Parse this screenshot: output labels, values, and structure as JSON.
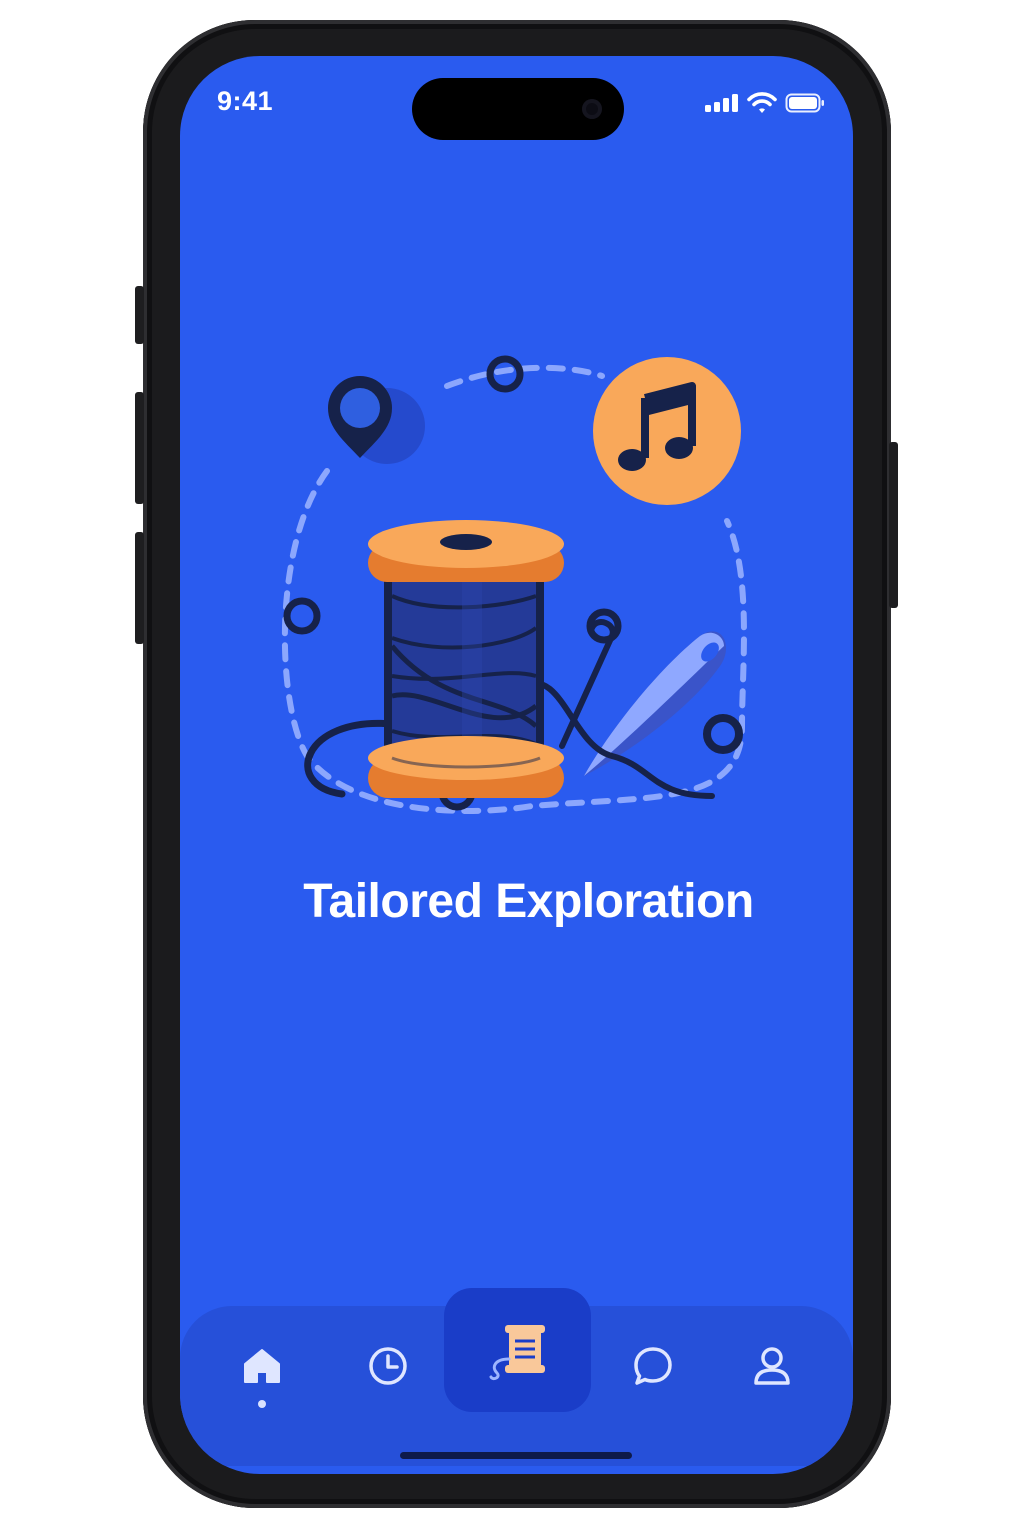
{
  "status_bar": {
    "time": "9:41",
    "icons": [
      "cellular-signal-icon",
      "wifi-icon",
      "battery-icon"
    ]
  },
  "onboarding": {
    "title": "Tailored Exploration",
    "illustration": {
      "elements": [
        "thread-spool",
        "sewing-needle",
        "map-pin-icon",
        "music-note-icon",
        "dashed-path"
      ]
    }
  },
  "tab_bar": {
    "tabs": [
      {
        "name": "home",
        "icon": "home-icon",
        "active": false,
        "indicator_dot": true
      },
      {
        "name": "history",
        "icon": "clock-icon",
        "active": false
      },
      {
        "name": "spool",
        "icon": "spool-icon",
        "active": true
      },
      {
        "name": "chat",
        "icon": "chat-bubble-icon",
        "active": false
      },
      {
        "name": "profile",
        "icon": "user-icon",
        "active": false
      }
    ]
  },
  "colors": {
    "background": "#2a5bef",
    "tab_bar": "#2650d9",
    "active_tab": "#1a3dc8",
    "accent_orange": "#f9a85a",
    "spool_orange": "#f08c3c",
    "navy": "#16224a",
    "thread_blue": "#27399a"
  }
}
